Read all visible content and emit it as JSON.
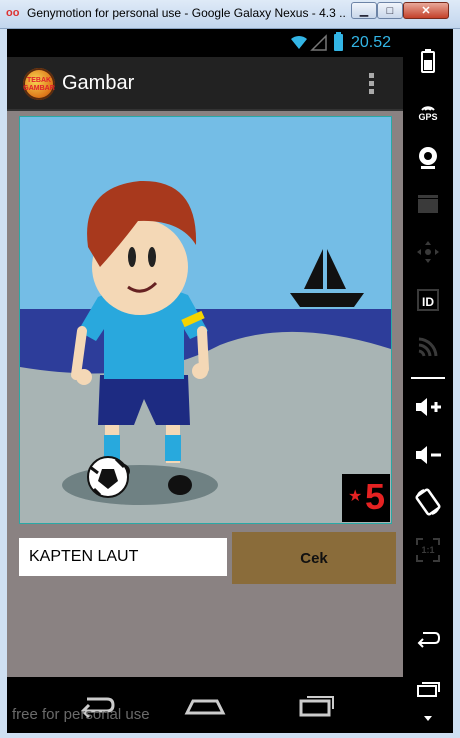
{
  "window": {
    "title": "Genymotion for personal use - Google Galaxy Nexus - 4.3 ...",
    "app_icon": "oo",
    "minimize": "▁",
    "maximize": "□",
    "close": "✕"
  },
  "statusbar": {
    "time": "20.52"
  },
  "actionbar": {
    "title": "Gambar",
    "logo_line1": "TEBAK",
    "logo_line2": "GAMBAR"
  },
  "puzzle": {
    "stars": "5",
    "star_glyph": "★"
  },
  "answer": {
    "value": "KAPTEN LAUT"
  },
  "check_button": {
    "label": "Cek"
  },
  "watermark": "free for personal use",
  "sidebar": {
    "gps_label": "GPS",
    "id_label": "ID",
    "pixel_label": "1:1"
  },
  "colors": {
    "accent": "#33b5e5",
    "button": "#8a6c3a",
    "background": "#8a8282"
  }
}
